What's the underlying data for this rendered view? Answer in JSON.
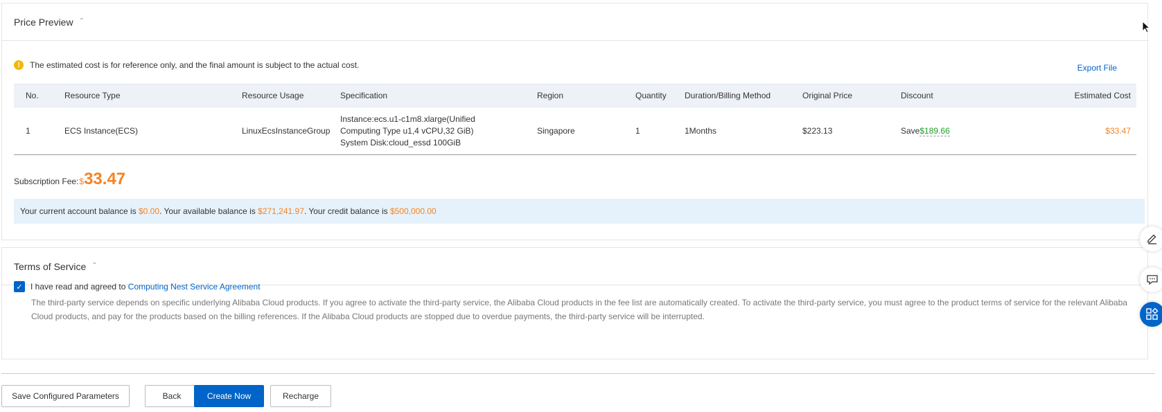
{
  "price_preview": {
    "title": "Price Preview",
    "notice": "The estimated cost is for reference only, and the final amount is subject to the actual cost.",
    "export_label": "Export File",
    "columns": [
      "No.",
      "Resource Type",
      "Resource Usage",
      "Specification",
      "Region",
      "Quantity",
      "Duration/Billing Method",
      "Original Price",
      "Discount",
      "Estimated Cost"
    ],
    "rows": [
      {
        "no": "1",
        "resource_type": "ECS Instance(ECS)",
        "resource_usage": "LinuxEcsInstanceGroup",
        "spec_line1": "Instance:ecs.u1-c1m8.xlarge(Unified",
        "spec_line2": "Computing Type u1,4 vCPU,32 GiB)",
        "spec_line3": "System Disk:cloud_essd 100GiB",
        "region": "Singapore",
        "quantity": "1",
        "duration": "1Months",
        "original_price": "$223.13",
        "discount_prefix": "Save",
        "discount_amount": "$189.66",
        "estimated_cost": "$33.47"
      }
    ],
    "subscription_label": "Subscription Fee:",
    "subscription_currency": "$",
    "subscription_amount": "33.47",
    "balance": {
      "t1": "Your current account balance is ",
      "current": "$0.00",
      "t2": ". Your available balance is ",
      "available": "$271,241.97",
      "t3": ". Your credit balance is ",
      "credit": "$500,000.00"
    }
  },
  "terms": {
    "title": "Terms of Service",
    "checked": true,
    "agree_text": "I have read and agreed to ",
    "agree_link": "Computing Nest Service Agreement",
    "description": "The third-party service depends on specific underlying Alibaba Cloud products. If you agree to activate the third-party service, the Alibaba Cloud products in the fee list are automatically created. To activate the third-party service, you must agree to the product terms of service for the relevant Alibaba Cloud products, and pay for the products based on the billing references. If the Alibaba Cloud products are stopped due to overdue payments, the third-party service will be interrupted."
  },
  "actions": {
    "save": "Save Configured Parameters",
    "back": "Back",
    "create": "Create Now",
    "recharge": "Recharge"
  },
  "side_tools": [
    "edit-icon",
    "feedback-icon",
    "apps-icon"
  ],
  "colors": {
    "accent": "#0064c8",
    "price": "#f5821f",
    "discount": "#1e9d2c",
    "balance_bg": "#e6f2fb",
    "warning": "#f5b800"
  }
}
